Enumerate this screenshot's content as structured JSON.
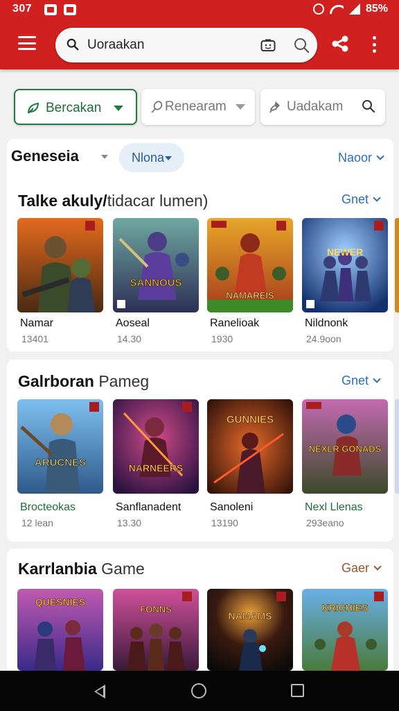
{
  "status_bar": {
    "time": "307",
    "battery": "85%"
  },
  "search": {
    "query": "Uoraakan"
  },
  "filters": [
    {
      "label": "Bercakan",
      "icon": "leaf-icon",
      "active": true
    },
    {
      "label": "Renearam",
      "icon": "pen-icon",
      "active": false
    },
    {
      "label": "Uadakam",
      "icon": "sword-icon",
      "active": false
    }
  ],
  "genre": {
    "label": "Geneseia",
    "pill": "Nlona",
    "link": "Naoor"
  },
  "sections": [
    {
      "title_bold": "Talke akuly/",
      "title_rest": "tidacar lumen)",
      "link": "Gnet",
      "games": [
        {
          "name": "Namar",
          "sub": "13401",
          "name_color": "#111111"
        },
        {
          "name": "Aoseal",
          "sub": "14.30",
          "name_color": "#111111"
        },
        {
          "name": "Ranelioak",
          "sub": "1930",
          "name_color": "#111111"
        },
        {
          "name": "Nildnonk",
          "sub": "24.9oon",
          "name_color": "#111111"
        }
      ],
      "art_text": [
        "",
        "SANNOUS",
        "NAMAREIS",
        "NEWER"
      ]
    },
    {
      "title_bold": "Galrboran",
      "title_rest": "Pameg",
      "link": "Gnet",
      "games": [
        {
          "name": "Brocteokas",
          "sub": "12 lean",
          "name_color": "#1f6b38"
        },
        {
          "name": "Sanflanadent",
          "sub": "13.30",
          "name_color": "#111111"
        },
        {
          "name": "Sanoleni",
          "sub": "13190",
          "name_color": "#111111"
        },
        {
          "name": "Nexl Llenas",
          "sub": "293eano",
          "name_color": "#1f6b38"
        }
      ],
      "art_text": [
        "ARUCNES",
        "NARNEERS",
        "GUNNIES",
        "NEXLR GONADS"
      ]
    },
    {
      "title_bold": "Karrlanbia",
      "title_rest": "Game",
      "link": "Gaer",
      "games": [],
      "art_text": [
        "QUESNIES",
        "FONNS",
        "NAMAMS",
        "KRICHIES"
      ]
    }
  ],
  "colors": {
    "accent_red": "#d0201f",
    "link_blue": "#2b6fb6",
    "chip_green": "#1f7a3f",
    "link_brown": "#a0522d"
  }
}
